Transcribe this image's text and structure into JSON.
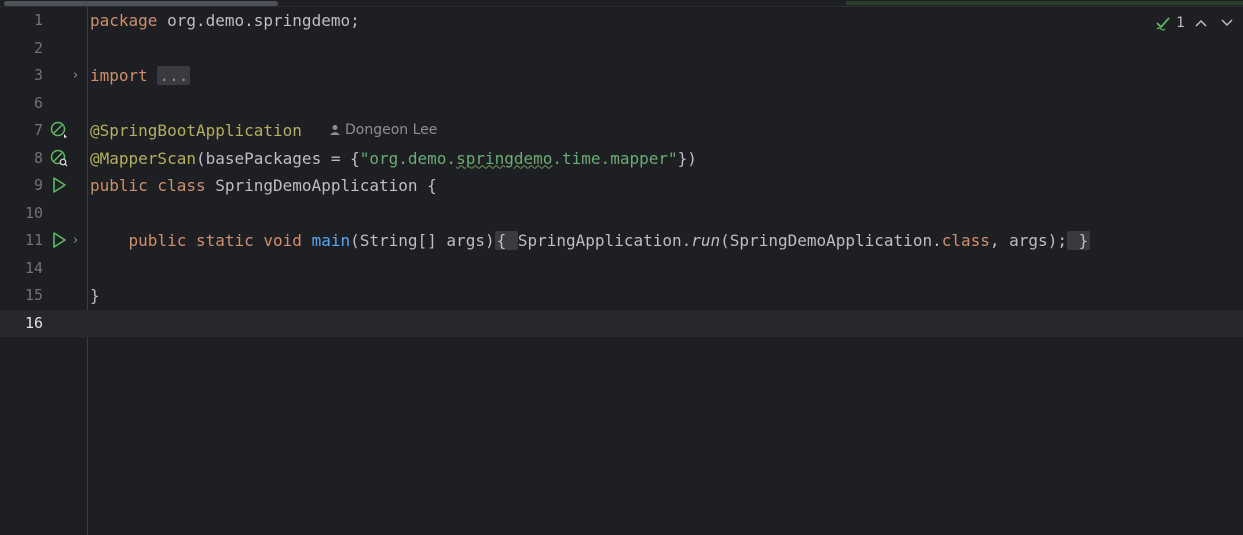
{
  "lines": [
    {
      "num": "1",
      "parts": [
        {
          "t": "package",
          "c": "kw"
        },
        {
          "t": " org.demo.springdemo;",
          "c": ""
        }
      ]
    },
    {
      "num": "2",
      "parts": []
    },
    {
      "num": "3",
      "parts": [
        {
          "t": "import",
          "c": "kw"
        },
        {
          "t": " ",
          "c": ""
        },
        {
          "t": "...",
          "c": "fold-dots"
        }
      ]
    },
    {
      "num": "6",
      "parts": []
    },
    {
      "num": "7",
      "parts": [
        {
          "t": "@SpringBootApplication",
          "c": "ann"
        }
      ]
    },
    {
      "num": "8",
      "parts": [
        {
          "t": "@MapperScan",
          "c": "ann"
        },
        {
          "t": "(basePackages = {",
          "c": ""
        },
        {
          "t": "\"org.demo.",
          "c": "str"
        },
        {
          "t": "springdemo",
          "c": "str squig"
        },
        {
          "t": ".time.mapper\"",
          "c": "str"
        },
        {
          "t": "})",
          "c": ""
        }
      ]
    },
    {
      "num": "9",
      "parts": [
        {
          "t": "public class",
          "c": "kw"
        },
        {
          "t": " SpringDemoApplication {",
          "c": ""
        }
      ]
    },
    {
      "num": "10",
      "parts": []
    },
    {
      "num": "11",
      "parts": [
        {
          "t": "    ",
          "c": ""
        },
        {
          "t": "public static void",
          "c": "kw"
        },
        {
          "t": " ",
          "c": ""
        },
        {
          "t": "main",
          "c": "fn"
        },
        {
          "t": "(String[] args)",
          "c": ""
        },
        {
          "t": "{ ",
          "c": "fold-box"
        },
        {
          "t": "SpringApplication.",
          "c": ""
        },
        {
          "t": "run",
          "c": "it"
        },
        {
          "t": "(SpringDemoApplication.",
          "c": ""
        },
        {
          "t": "class",
          "c": "kw"
        },
        {
          "t": ", args);",
          "c": ""
        },
        {
          "t": " }",
          "c": "fold-box"
        }
      ]
    },
    {
      "num": "14",
      "parts": []
    },
    {
      "num": "15",
      "parts": [
        {
          "t": "}",
          "c": ""
        }
      ]
    },
    {
      "num": "16",
      "parts": []
    }
  ],
  "inlay_author": "Dongeon Lee",
  "inspection_count": "1",
  "icons": {
    "line3_fold": "chevron-right-icon",
    "line7": "spring-bean-icon",
    "line8": "mapper-scan-icon",
    "line9": "run-icon",
    "line11": "run-icon",
    "inlay": "user-icon",
    "status": "check-icon"
  }
}
